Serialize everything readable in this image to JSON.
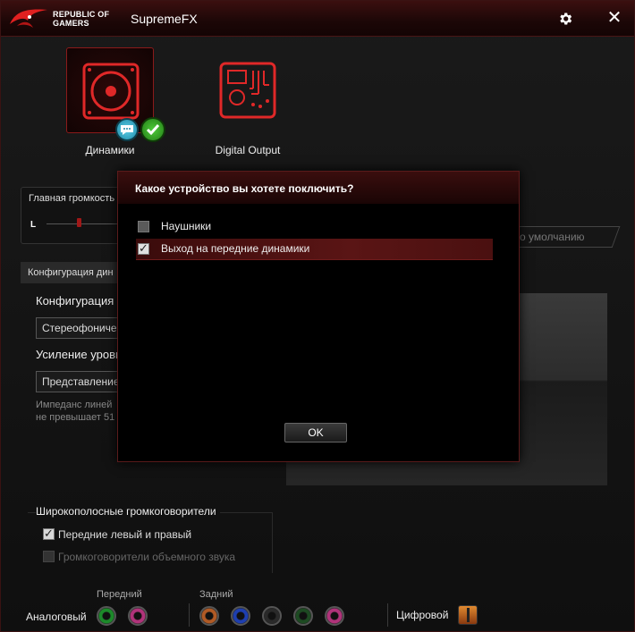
{
  "titlebar": {
    "brand_line1": "REPUBLIC OF",
    "brand_line2": "GAMERS",
    "app_title": "SupremeFX"
  },
  "devices": [
    {
      "label": "Динамики",
      "icon": "speaker-icon",
      "selected": true
    },
    {
      "label": "Digital Output",
      "icon": "circuit-board-icon",
      "selected": false
    }
  ],
  "volume": {
    "label": "Главная громкость",
    "channel": "L"
  },
  "defaults_button": "о умолчанию",
  "config": {
    "tab": "Конфигурация дин",
    "title": "Конфигурация д",
    "select": "Стереофоничес",
    "gain_title": "Усиление уровн",
    "gain_select": "Представление",
    "note_line1": "Импеданс линей",
    "note_line2": "не превышает 51"
  },
  "wideband": {
    "title": "Широкополосные громкоговорители",
    "front": {
      "label": "Передние левый и правый",
      "checked": true
    },
    "surround": {
      "label": "Громкоговорители объемного звука",
      "checked": false,
      "disabled": true
    }
  },
  "jacks": {
    "front_label": "Передний",
    "rear_label": "Задний",
    "analog_label": "Аналоговый",
    "digital_label": "Цифровой",
    "colors": {
      "green": "#1c8a2a",
      "pink": "#b0337a",
      "orange": "#b05a25",
      "blue": "#1e3fb0",
      "black": "#2a2a2a",
      "dkgreen": "#1d4a22"
    }
  },
  "modal": {
    "title": "Какое устройство вы хотете поключить?",
    "options": [
      {
        "label": "Наушники",
        "checked": false
      },
      {
        "label": "Выход на передние динамики",
        "checked": true
      }
    ],
    "ok": "OK"
  },
  "colors": {
    "accent": "#c41e1e",
    "background": "#111111"
  }
}
